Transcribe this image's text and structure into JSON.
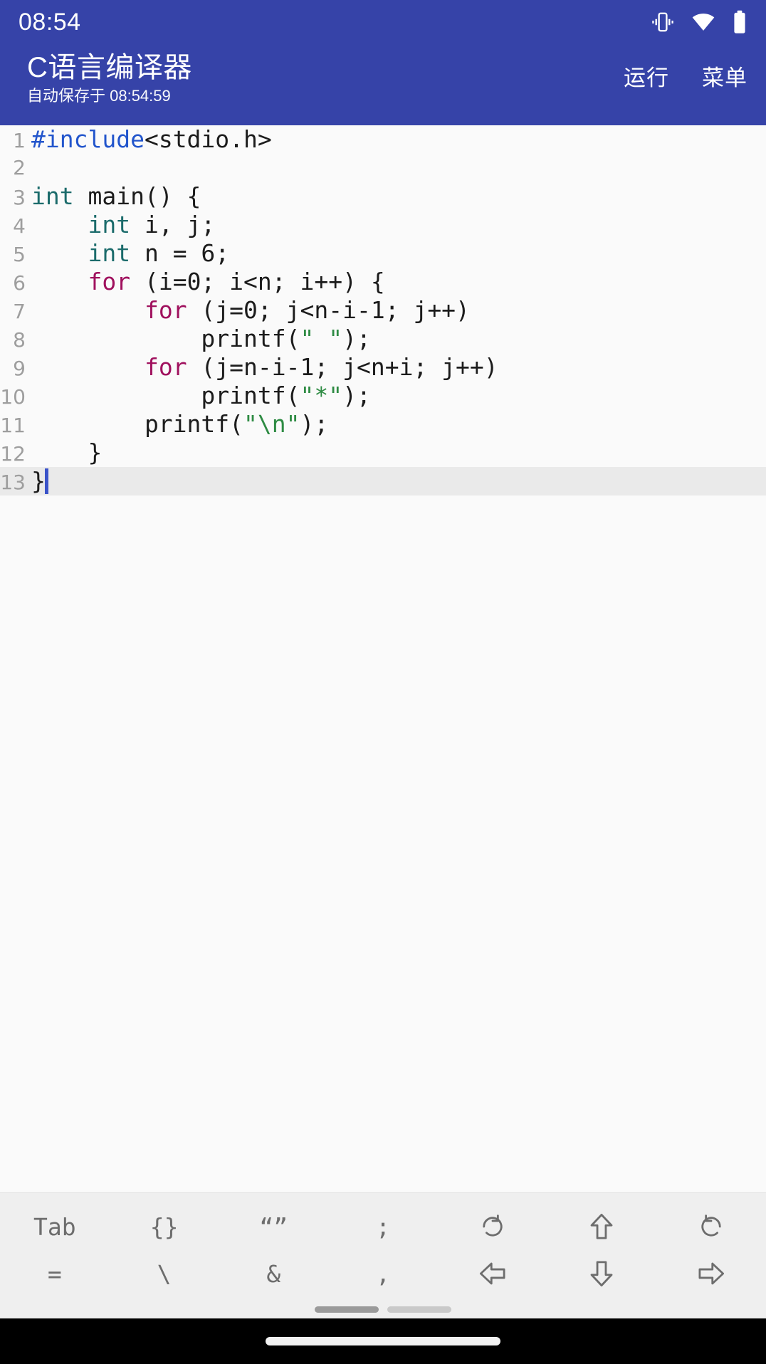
{
  "status_bar": {
    "clock": "08:54",
    "icons": [
      {
        "name": "vibrate-icon",
        "label": "vibrate"
      },
      {
        "name": "wifi-icon",
        "label": "wifi"
      },
      {
        "name": "battery-icon",
        "label": "battery"
      }
    ]
  },
  "app_bar": {
    "title": "C语言编译器",
    "subtitle": "自动保存于 08:54:59",
    "actions": [
      {
        "name": "run-button",
        "label": "运行"
      },
      {
        "name": "menu-button",
        "label": "菜单"
      }
    ],
    "background_color": "#3643a8",
    "text_color": "#ffffff"
  },
  "editor": {
    "active_line": 13,
    "cursor_line": 13,
    "cursor_column": 2,
    "font": "monospace",
    "colors": {
      "preprocessor": "#2255cc",
      "type": "#1b6b6b",
      "keyword": "#a0115e",
      "string": "#2e8b43",
      "plain": "#1c1c1c",
      "gutter": "#9e9e9e",
      "active_line_bg": "#eaeaea",
      "caret": "#3a53c9",
      "background": "#fafafa"
    },
    "lines": [
      {
        "number": "1",
        "tokens": [
          {
            "t": "pre",
            "s": "#include"
          },
          {
            "t": "plain",
            "s": "<stdio.h>"
          }
        ]
      },
      {
        "number": "2",
        "tokens": []
      },
      {
        "number": "3",
        "tokens": [
          {
            "t": "type",
            "s": "int"
          },
          {
            "t": "plain",
            "s": " main() {"
          }
        ]
      },
      {
        "number": "4",
        "tokens": [
          {
            "t": "plain",
            "s": "    "
          },
          {
            "t": "type",
            "s": "int"
          },
          {
            "t": "plain",
            "s": " i, j;"
          }
        ]
      },
      {
        "number": "5",
        "tokens": [
          {
            "t": "plain",
            "s": "    "
          },
          {
            "t": "type",
            "s": "int"
          },
          {
            "t": "plain",
            "s": " n = 6;"
          }
        ]
      },
      {
        "number": "6",
        "tokens": [
          {
            "t": "plain",
            "s": "    "
          },
          {
            "t": "kw",
            "s": "for"
          },
          {
            "t": "plain",
            "s": " (i=0; i<n; i++) {"
          }
        ]
      },
      {
        "number": "7",
        "tokens": [
          {
            "t": "plain",
            "s": "        "
          },
          {
            "t": "kw",
            "s": "for"
          },
          {
            "t": "plain",
            "s": " (j=0; j<n-i-1; j++)"
          }
        ]
      },
      {
        "number": "8",
        "tokens": [
          {
            "t": "plain",
            "s": "            printf("
          },
          {
            "t": "str",
            "s": "\" \""
          },
          {
            "t": "plain",
            "s": ");"
          }
        ]
      },
      {
        "number": "9",
        "tokens": [
          {
            "t": "plain",
            "s": "        "
          },
          {
            "t": "kw",
            "s": "for"
          },
          {
            "t": "plain",
            "s": " (j=n-i-1; j<n+i; j++)"
          }
        ]
      },
      {
        "number": "10",
        "tokens": [
          {
            "t": "plain",
            "s": "            printf("
          },
          {
            "t": "str",
            "s": "\"*\""
          },
          {
            "t": "plain",
            "s": ");"
          }
        ]
      },
      {
        "number": "11",
        "tokens": [
          {
            "t": "plain",
            "s": "        printf("
          },
          {
            "t": "str",
            "s": "\"\\n\""
          },
          {
            "t": "plain",
            "s": ");"
          }
        ]
      },
      {
        "number": "12",
        "tokens": [
          {
            "t": "plain",
            "s": "    }"
          }
        ]
      },
      {
        "number": "13",
        "tokens": [
          {
            "t": "plain",
            "s": "}"
          }
        ],
        "active": true,
        "caret": true
      }
    ],
    "source_code": "#include<stdio.h>\n\nint main() {\n    int i, j;\n    int n = 6;\n    for (i=0; i<n; i++) {\n        for (j=0; j<n-i-1; j++)\n            printf(\" \");\n        for (j=n-i-1; j<n+i; j++)\n            printf(\"*\");\n        printf(\"\\n\");\n    }\n}"
  },
  "key_toolbar": {
    "row1": [
      {
        "name": "key-tab",
        "label": "Tab",
        "icon": null
      },
      {
        "name": "key-braces",
        "label": "{}",
        "icon": null
      },
      {
        "name": "key-quotes",
        "label": "“”",
        "icon": null
      },
      {
        "name": "key-semicolon",
        "label": ";",
        "icon": null
      },
      {
        "name": "key-undo",
        "label": "",
        "icon": "undo-icon"
      },
      {
        "name": "key-arrow-up",
        "label": "",
        "icon": "arrow-up-icon"
      },
      {
        "name": "key-redo",
        "label": "",
        "icon": "redo-icon"
      }
    ],
    "row2": [
      {
        "name": "key-equals",
        "label": "=",
        "icon": null
      },
      {
        "name": "key-backslash",
        "label": "\\",
        "icon": null
      },
      {
        "name": "key-ampersand",
        "label": "&",
        "icon": null
      },
      {
        "name": "key-comma",
        "label": ",",
        "icon": null
      },
      {
        "name": "key-arrow-left",
        "label": "",
        "icon": "arrow-left-icon"
      },
      {
        "name": "key-arrow-down",
        "label": "",
        "icon": "arrow-down-icon"
      },
      {
        "name": "key-arrow-right",
        "label": "",
        "icon": "arrow-right-icon"
      }
    ],
    "background_color": "#efefef",
    "text_color": "#6d6d6d"
  },
  "nav_bar": {
    "gesture_pill": true
  }
}
